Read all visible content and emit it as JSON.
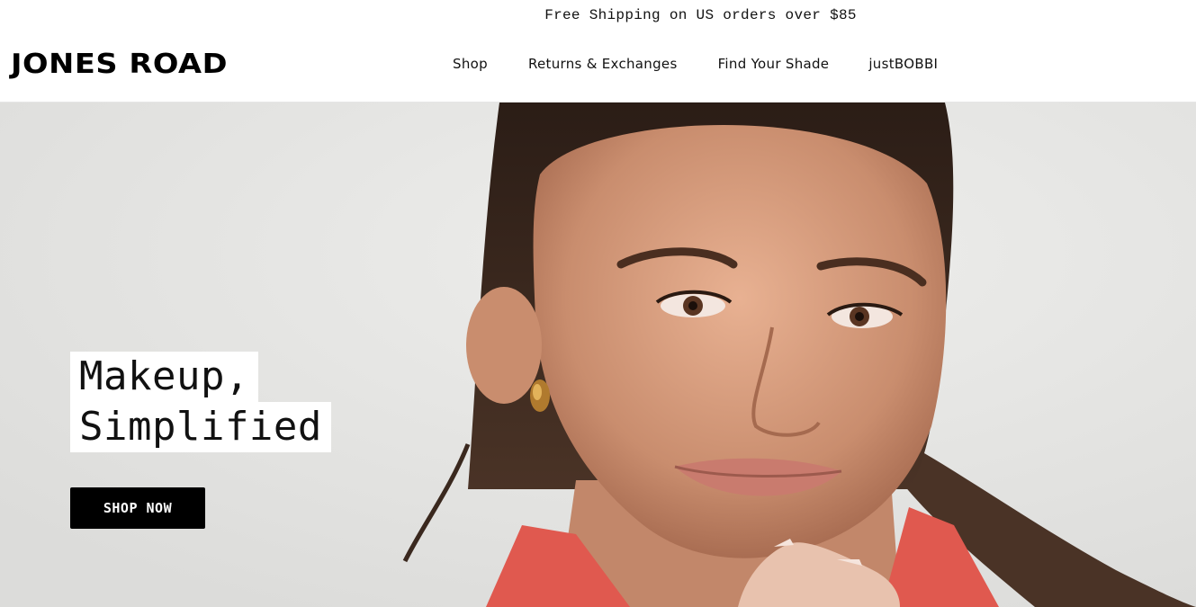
{
  "announcement": {
    "text": "Free Shipping on US orders over $85"
  },
  "header": {
    "logo": "JONES ROAD",
    "nav": [
      {
        "label": "Shop"
      },
      {
        "label": "Returns & Exchanges"
      },
      {
        "label": "Find Your Shade"
      },
      {
        "label": "justBOBBI"
      }
    ]
  },
  "hero": {
    "headline_line1": "Makeup,",
    "headline_line2": "Simplified",
    "cta_label": "SHOP NOW",
    "image_subject": "smiling woman with dark hair pulled back, gold hoop earring, red collar"
  },
  "colors": {
    "background": "#ffffff",
    "hero_background": "#e8e8e6",
    "button": "#000000",
    "button_text": "#ffffff",
    "text": "#111111"
  }
}
